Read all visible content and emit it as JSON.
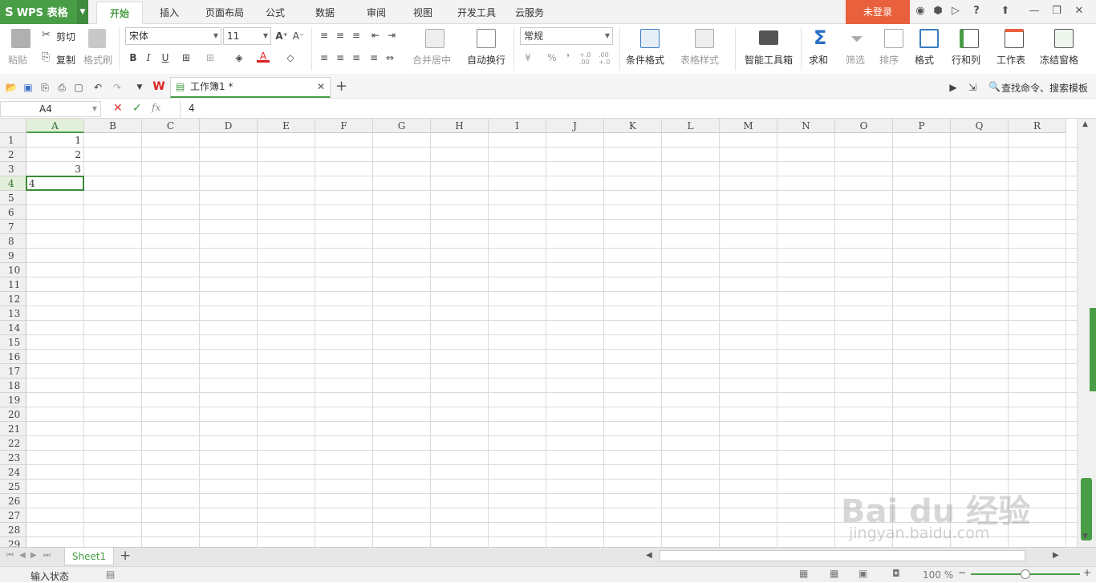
{
  "app": {
    "logo_text": "WPS 表格",
    "logo_letter": "S"
  },
  "menu_tabs": [
    "开始",
    "插入",
    "页面布局",
    "公式",
    "数据",
    "审阅",
    "视图",
    "开发工具",
    "云服务"
  ],
  "login_label": "未登录",
  "titlebar_icons": {
    "help": "?"
  },
  "ribbon": {
    "paste": "粘贴",
    "cut": "剪切",
    "copy": "复制",
    "format_painter": "格式刷",
    "font_name": "宋体",
    "font_size": "11",
    "bold": "B",
    "italic": "I",
    "underline": "U",
    "font_color_letter": "A",
    "merge_center": "合并居中",
    "wrap_text": "自动换行",
    "number_format": "常规",
    "percent": "%",
    "comma": "❜",
    "inc_decimal": "+.0 .00",
    "dec_decimal": ".00 +.0",
    "cond_format": "条件格式",
    "table_style": "表格样式",
    "smart_toolbox": "智能工具箱",
    "sum": "求和",
    "filter": "筛选",
    "sort": "排序",
    "format": "格式",
    "row_col": "行和列",
    "worksheet": "工作表",
    "freeze": "冻结窗格"
  },
  "doc_tab": {
    "title": "工作簿1 *"
  },
  "search": {
    "label": "查找命令、搜索模板"
  },
  "formula_bar": {
    "name_box": "A4",
    "fx": "fx",
    "value": "4"
  },
  "columns": [
    "A",
    "B",
    "C",
    "D",
    "E",
    "F",
    "G",
    "H",
    "I",
    "J",
    "K",
    "L",
    "M",
    "N",
    "O",
    "P",
    "Q",
    "R"
  ],
  "rows": [
    "1",
    "2",
    "3",
    "4",
    "5",
    "6",
    "7",
    "8",
    "9",
    "10",
    "11",
    "12",
    "13",
    "14",
    "15",
    "16",
    "17",
    "18",
    "19",
    "20",
    "21",
    "22",
    "23",
    "24",
    "25",
    "26",
    "27",
    "28",
    "29"
  ],
  "cells": [
    {
      "text": "1"
    },
    {
      "text": "2"
    },
    {
      "text": "3"
    },
    {
      "text": "4"
    }
  ],
  "sheet_tab": "Sheet1",
  "status": {
    "mode": "输入状态",
    "zoom": "100 %"
  },
  "watermark": {
    "line1": "Bai du 经验",
    "line2": "jingyan.baidu.com"
  },
  "colors": {
    "accent": "#4a9d47",
    "login_bg": "#e8613c",
    "selection": "#3c8a39"
  }
}
